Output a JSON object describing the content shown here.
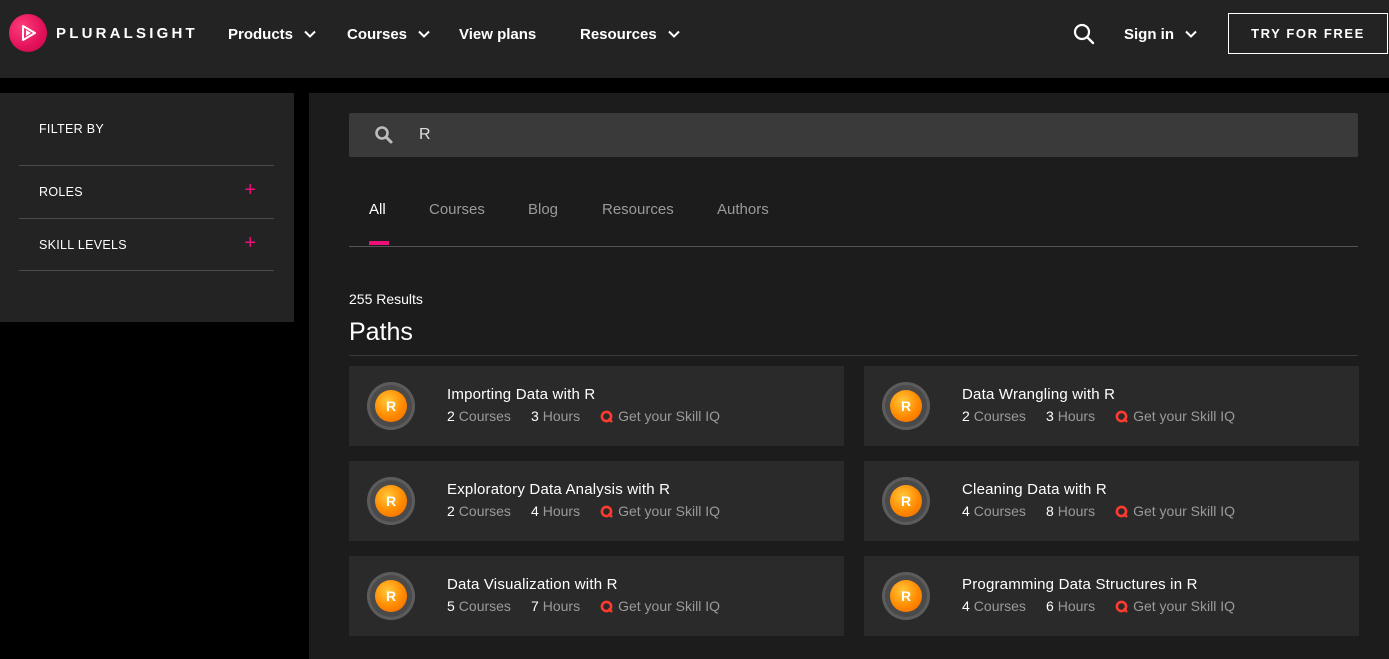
{
  "colors": {
    "brand_pink": "#ec0f7a",
    "badge_orange": "#ff8a00",
    "skill_red": "#ff3b30"
  },
  "header": {
    "logo_text": "PLURALSIGHT",
    "nav": [
      {
        "label": "Products",
        "has_dropdown": true
      },
      {
        "label": "Courses",
        "has_dropdown": true
      },
      {
        "label": "View plans",
        "has_dropdown": false
      },
      {
        "label": "Resources",
        "has_dropdown": true
      }
    ],
    "sign_in": "Sign in",
    "try_button": "TRY FOR FREE"
  },
  "sidebar": {
    "title": "FILTER BY",
    "filters": [
      {
        "label": "ROLES"
      },
      {
        "label": "SKILL LEVELS"
      }
    ]
  },
  "search": {
    "value": "R"
  },
  "tabs": [
    {
      "label": "All",
      "active": true
    },
    {
      "label": "Courses",
      "active": false
    },
    {
      "label": "Blog",
      "active": false
    },
    {
      "label": "Resources",
      "active": false
    },
    {
      "label": "Authors",
      "active": false
    }
  ],
  "results": {
    "count_label": "255 Results",
    "section_title": "Paths",
    "courses_word": "Courses",
    "hours_word": "Hours",
    "skill_iq": "Get your Skill IQ",
    "badge_letter": "R",
    "cards": [
      {
        "title": "Importing Data with R",
        "courses": "2",
        "hours": "3"
      },
      {
        "title": "Data Wrangling with R",
        "courses": "2",
        "hours": "3"
      },
      {
        "title": "Exploratory Data Analysis with R",
        "courses": "2",
        "hours": "4"
      },
      {
        "title": "Cleaning Data with R",
        "courses": "4",
        "hours": "8"
      },
      {
        "title": "Data Visualization with R",
        "courses": "5",
        "hours": "7"
      },
      {
        "title": "Programming Data Structures in R",
        "courses": "4",
        "hours": "6"
      }
    ]
  }
}
